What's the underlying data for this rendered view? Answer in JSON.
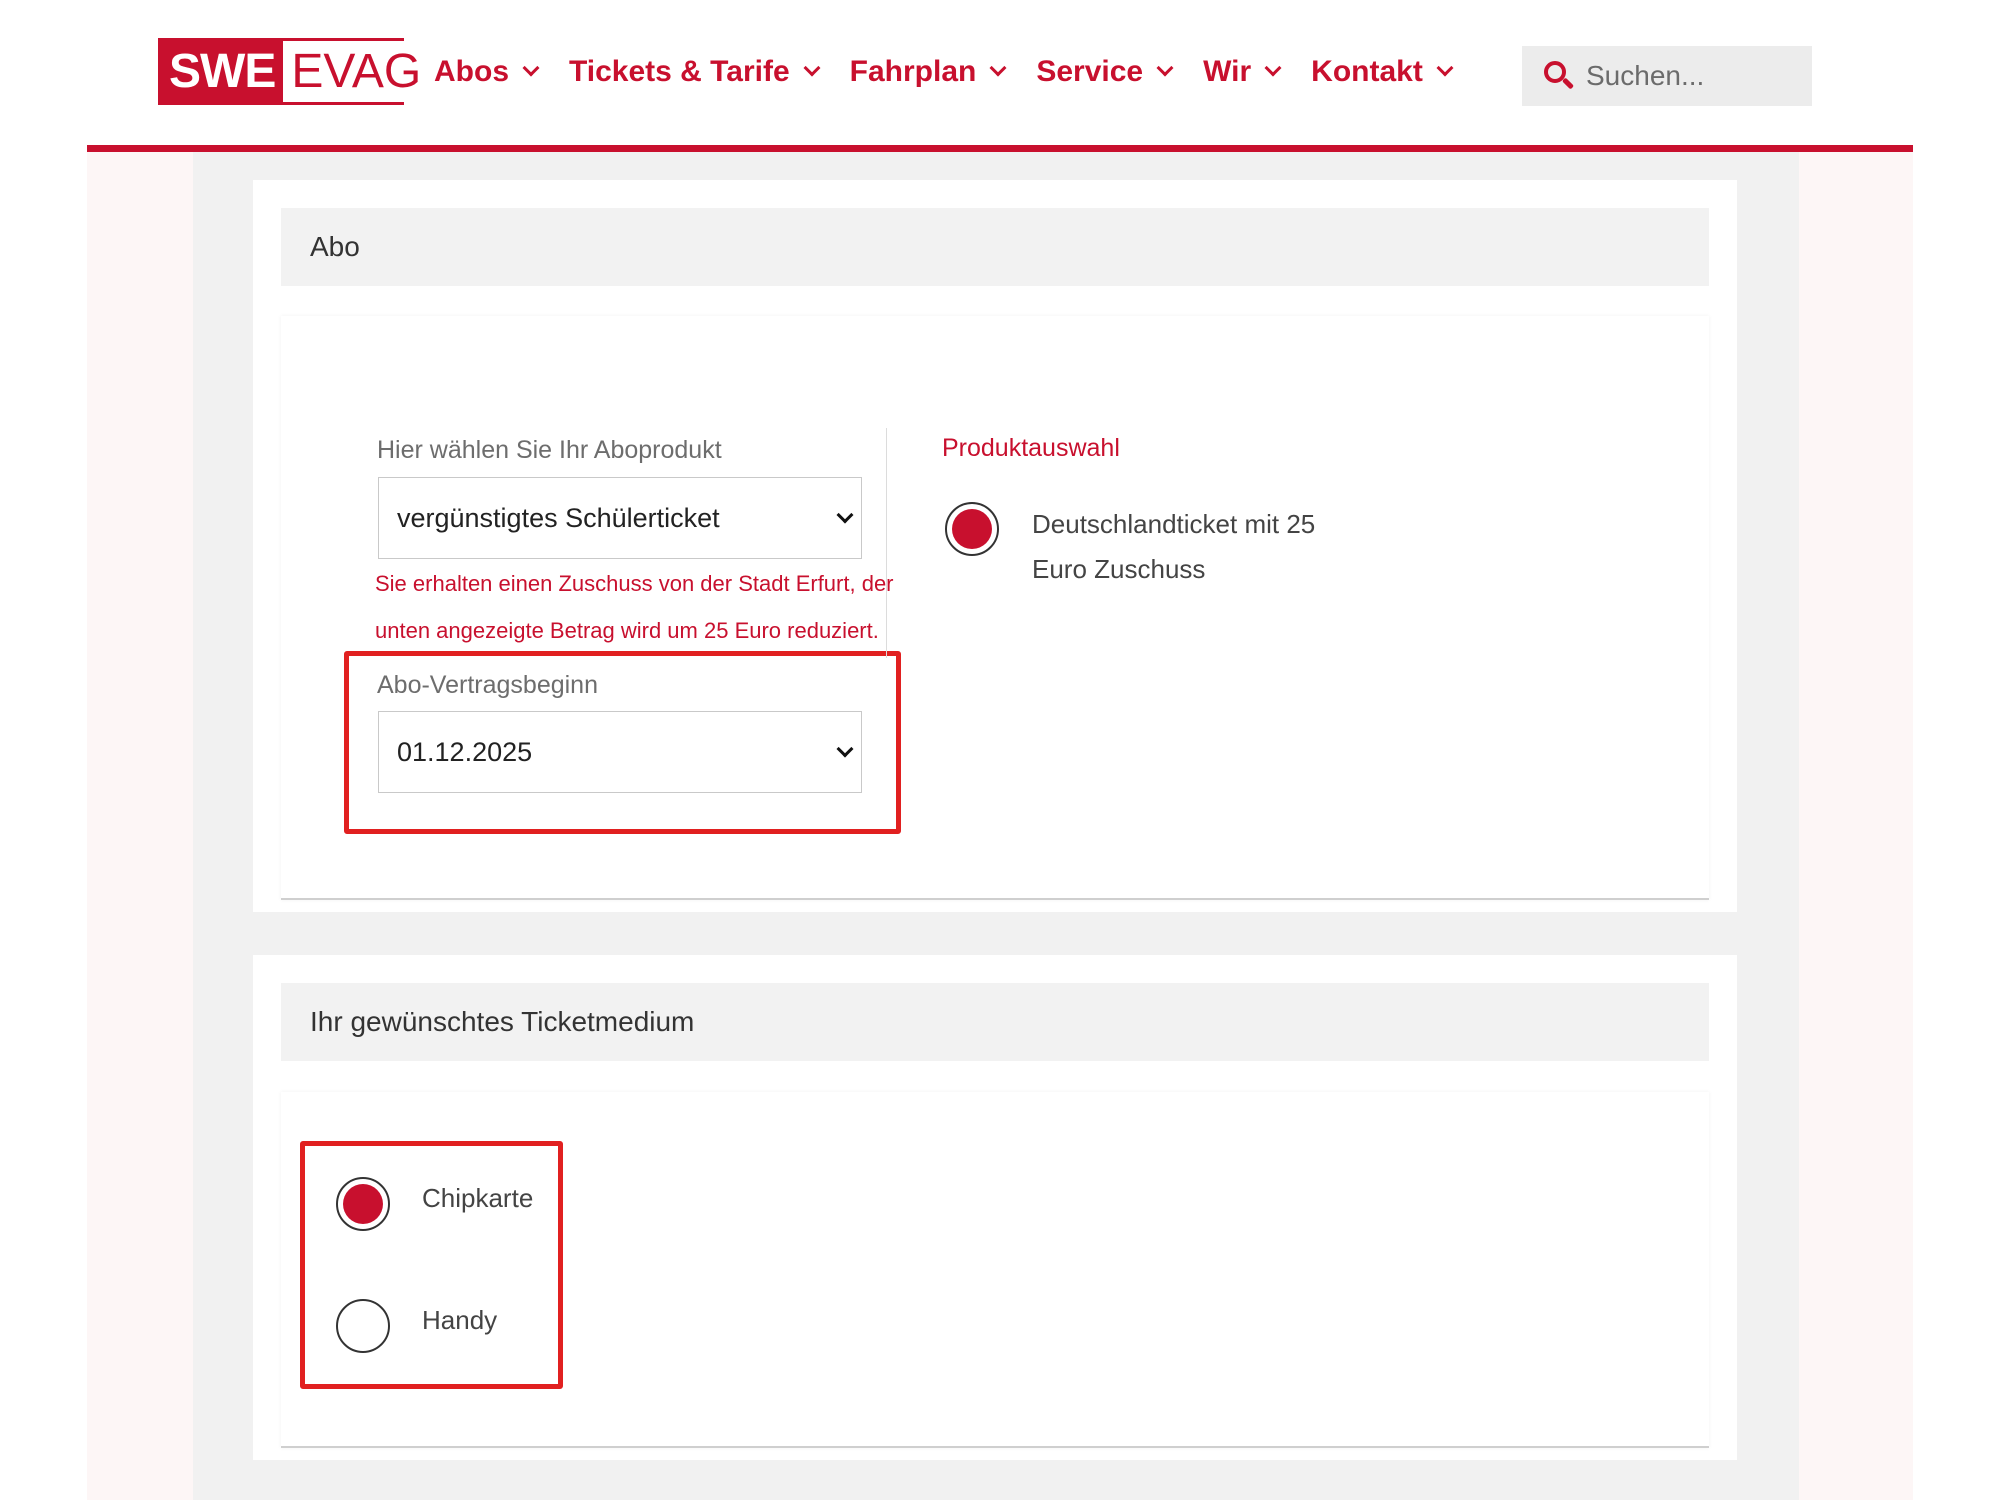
{
  "brand": {
    "logo_left": "SWE",
    "logo_right": "EVAG",
    "accent_color": "#c8102e"
  },
  "nav": {
    "items": [
      {
        "label": "Abos"
      },
      {
        "label": "Tickets & Tarife"
      },
      {
        "label": "Fahrplan"
      },
      {
        "label": "Service"
      },
      {
        "label": "Wir"
      },
      {
        "label": "Kontakt"
      }
    ]
  },
  "search": {
    "placeholder": "Suchen...",
    "icon": "search-icon"
  },
  "abo_section": {
    "title": "Abo",
    "product_select": {
      "label": "Hier wählen Sie Ihr Aboprodukt",
      "value": "vergünstigtes Schülerticket"
    },
    "hint": "Sie erhalten einen Zuschuss von der Stadt Erfurt, der unten angezeigte Betrag wird um 25 Euro reduziert.",
    "start_select": {
      "label": "Abo-Vertragsbeginn",
      "value": "01.12.2025"
    },
    "product_choice": {
      "title": "Produktauswahl",
      "option": "Deutschlandticket mit 25 Euro Zuschuss",
      "selected": true
    }
  },
  "medium_section": {
    "title": "Ihr gewünschtes Ticketmedium",
    "options": [
      {
        "label": "Chipkarte",
        "selected": true
      },
      {
        "label": "Handy",
        "selected": false
      }
    ]
  }
}
